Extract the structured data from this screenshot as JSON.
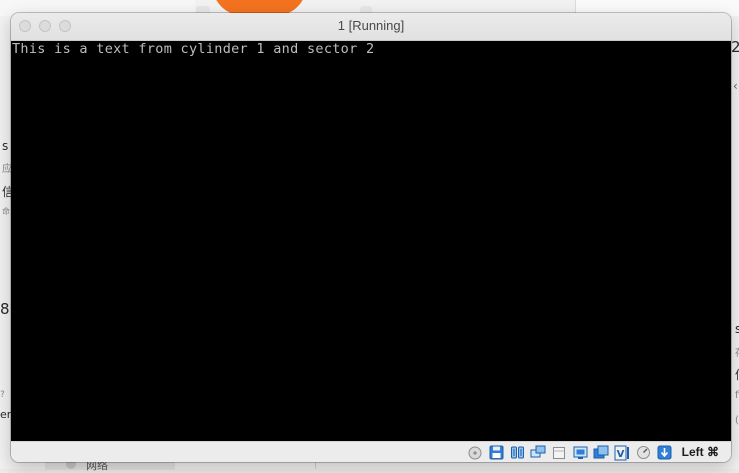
{
  "vm_window": {
    "title": "1 [Running]",
    "console_text": "This is a text from cylinder 1 and sector 2",
    "statusbar": {
      "icons": [
        "optical-drive-icon",
        "floppy-icon",
        "audio-icon",
        "network-icon",
        "usb-icon",
        "shared-folder-icon",
        "display-icon",
        "recording-icon",
        "cpu-icon",
        "mouse-integration-icon",
        "host-key-arrow-icon"
      ],
      "host_key_label": "Left ⌘"
    }
  },
  "background": {
    "bottom_item_label": "网络",
    "fragments": {
      "right_number": "2",
      "left_s": "s",
      "left_cjk_1": "应",
      "left_cjk_2": "信",
      "left_small": "命",
      "left_symbol": "8",
      "left_bottom_small": "?",
      "left_era": "era",
      "right_s": "s",
      "right_small_1": "存",
      "right_cjk": "信",
      "right_small_2": "fi",
      "right_small_3": "(",
      "right_chevron": "‹"
    }
  }
}
